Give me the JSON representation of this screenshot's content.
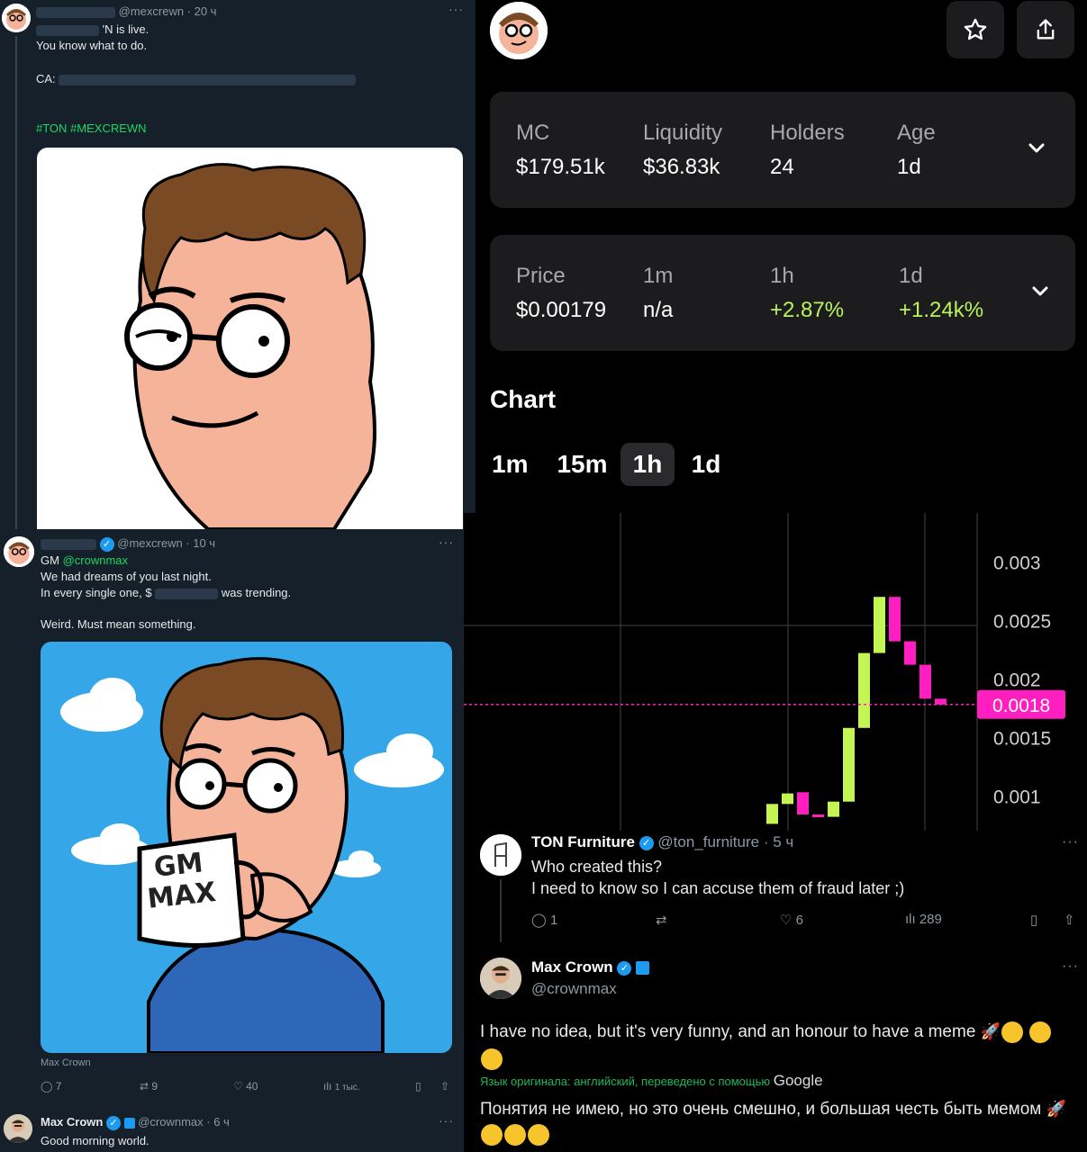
{
  "tweet1": {
    "handle": "@mexcrewn · 20 ч",
    "line1": "'N is live.",
    "line2": "You know what to do.",
    "ca": "CA:",
    "hashtags": "#TON #MEXCREWN"
  },
  "tweet2": {
    "handle": "@mexcrewn · 10 ч",
    "gm": "GM",
    "mention": "@crownmax",
    "line1": "We had dreams of you last night.",
    "line2_a": "In every single one, $",
    "line2_b": "was trending.",
    "line3": "Weird. Must mean something.",
    "mug_text": "GM MAX",
    "caption": "Max Crown",
    "replies": "7",
    "retweets": "9",
    "likes": "40",
    "views": "1 тыс."
  },
  "tweet3": {
    "name": "Max Crown",
    "handle": "@crownmax · 6 ч",
    "text": "Good morning world."
  },
  "token": {
    "stats": [
      {
        "label": "MC",
        "value": "$179.51k"
      },
      {
        "label": "Liquidity",
        "value": "$36.83k"
      },
      {
        "label": "Holders",
        "value": "24"
      },
      {
        "label": "Age",
        "value": "1d"
      }
    ],
    "price": [
      {
        "label": "Price",
        "value": "$0.00179"
      },
      {
        "label": "1m",
        "value": "n/a"
      },
      {
        "label": "1h",
        "value": "+2.87%"
      },
      {
        "label": "1d",
        "value": "+1.24k%"
      }
    ],
    "chart_title": "Chart",
    "timeframes": [
      "1m",
      "15m",
      "1h",
      "1d"
    ],
    "active_timeframe": "1h"
  },
  "chart_data": {
    "type": "candlestick",
    "y_ticks": [
      "0.003",
      "0.0025",
      "0.002",
      "0.0015",
      "0.001"
    ],
    "ylim": [
      0.00075,
      0.00325
    ],
    "current_price_label": "0.0018",
    "current_price": 0.00179,
    "candles": [
      {
        "open": 0.00077,
        "close": 0.00094,
        "dir": "up"
      },
      {
        "open": 0.00094,
        "close": 0.00103,
        "dir": "up"
      },
      {
        "open": 0.00104,
        "close": 0.00085,
        "dir": "down"
      },
      {
        "open": 0.00085,
        "close": 0.00083,
        "dir": "down"
      },
      {
        "open": 0.00083,
        "close": 0.00096,
        "dir": "up"
      },
      {
        "open": 0.00096,
        "close": 0.00159,
        "dir": "up"
      },
      {
        "open": 0.00159,
        "close": 0.00223,
        "dir": "up"
      },
      {
        "open": 0.00223,
        "close": 0.00271,
        "dir": "up"
      },
      {
        "open": 0.00271,
        "close": 0.00233,
        "dir": "down"
      },
      {
        "open": 0.00233,
        "close": 0.00213,
        "dir": "down"
      },
      {
        "open": 0.00213,
        "close": 0.00184,
        "dir": "down"
      },
      {
        "open": 0.00184,
        "close": 0.00179,
        "dir": "down"
      }
    ],
    "colors": {
      "up": "#c4f553",
      "down": "#ff1fc0"
    }
  },
  "reply1": {
    "name": "TON Furniture",
    "handle": "@ton_furniture · 5 ч",
    "line1": "Who created this?",
    "line2": "I need to know so I can accuse them of fraud later ;)",
    "replies": "1",
    "likes": "6",
    "views": "289"
  },
  "reply2": {
    "name": "Max Crown",
    "handle": "@crownmax",
    "text": "I have no idea, but it's very funny, and an honour to have a meme",
    "translation_note": "Язык оригинала: английский, переведено с помощью",
    "translator": "Google",
    "translated": "Понятия не имею, но это очень смешно, и большая честь быть мемом"
  }
}
